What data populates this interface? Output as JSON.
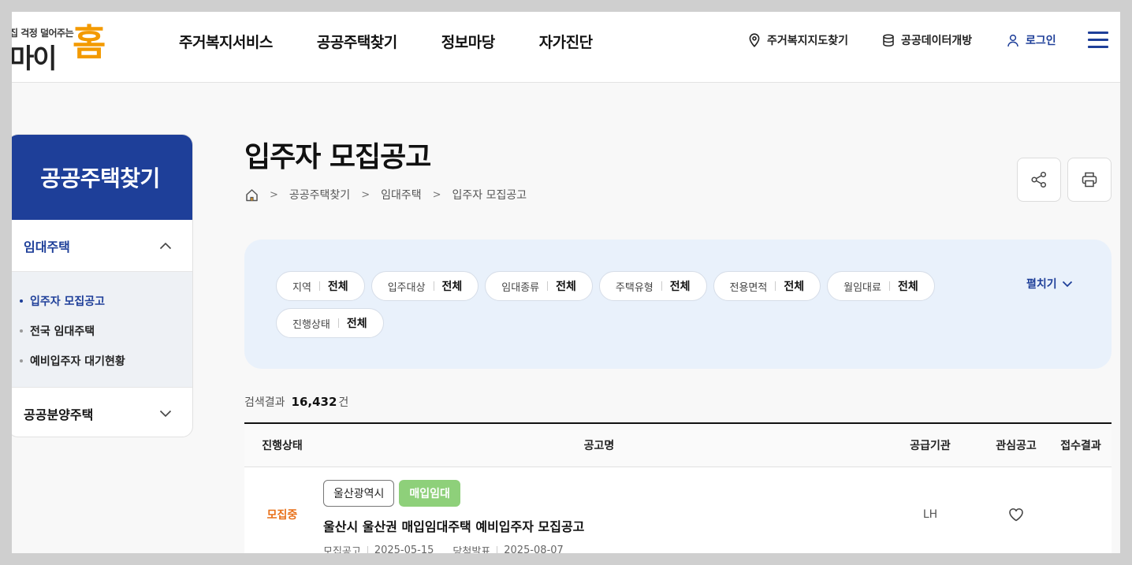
{
  "logo": {
    "tagline": "집 걱정 덜어주는",
    "brand_main": "마이",
    "brand_accent": "홈"
  },
  "gnb": [
    "주거복지서비스",
    "공공주택찾기",
    "정보마당",
    "자가진단"
  ],
  "util": {
    "map": "주거복지지도찾기",
    "data": "공공데이터개방",
    "login": "로그인"
  },
  "sidebar": {
    "title": "공공주택찾기",
    "sections": [
      {
        "label": "임대주택",
        "expanded": true,
        "items": [
          "입주자 모집공고",
          "전국 임대주택",
          "예비입주자 대기현황"
        ]
      },
      {
        "label": "공공분양주택",
        "expanded": false
      }
    ]
  },
  "page": {
    "title": "입주자 모집공고",
    "breadcrumb": [
      "공공주택찾기",
      "임대주택",
      "입주자 모집공고"
    ]
  },
  "filters": {
    "chips": [
      {
        "key": "지역",
        "value": "전체"
      },
      {
        "key": "입주대상",
        "value": "전체"
      },
      {
        "key": "임대종류",
        "value": "전체"
      },
      {
        "key": "주택유형",
        "value": "전체"
      },
      {
        "key": "전용면적",
        "value": "전체"
      },
      {
        "key": "월임대료",
        "value": "전체"
      },
      {
        "key": "진행상태",
        "value": "전체"
      }
    ],
    "expand_label": "펼치기"
  },
  "result": {
    "label": "검색결과",
    "count": "16,432",
    "unit": "건"
  },
  "table": {
    "headers": [
      "진행상태",
      "공고명",
      "공급기관",
      "관심공고",
      "접수결과"
    ],
    "rows": [
      {
        "status": "모집중",
        "region_tag": "울산광역시",
        "type_tag": "매입임대",
        "title": "울산시 울산권 매입임대주택 예비입주자 모집공고",
        "notice_label": "모집공고",
        "notice_date": "2025-05-15",
        "announce_label": "당첨발표",
        "announce_date": "2025-08-07",
        "agency": "LH"
      }
    ]
  },
  "colors": {
    "brand_blue": "#1e3f99",
    "logo_orange": "#f39a00",
    "status_orange": "#e8701a",
    "tag_green": "#8ed07a",
    "filter_bg": "#e9f1fb"
  }
}
